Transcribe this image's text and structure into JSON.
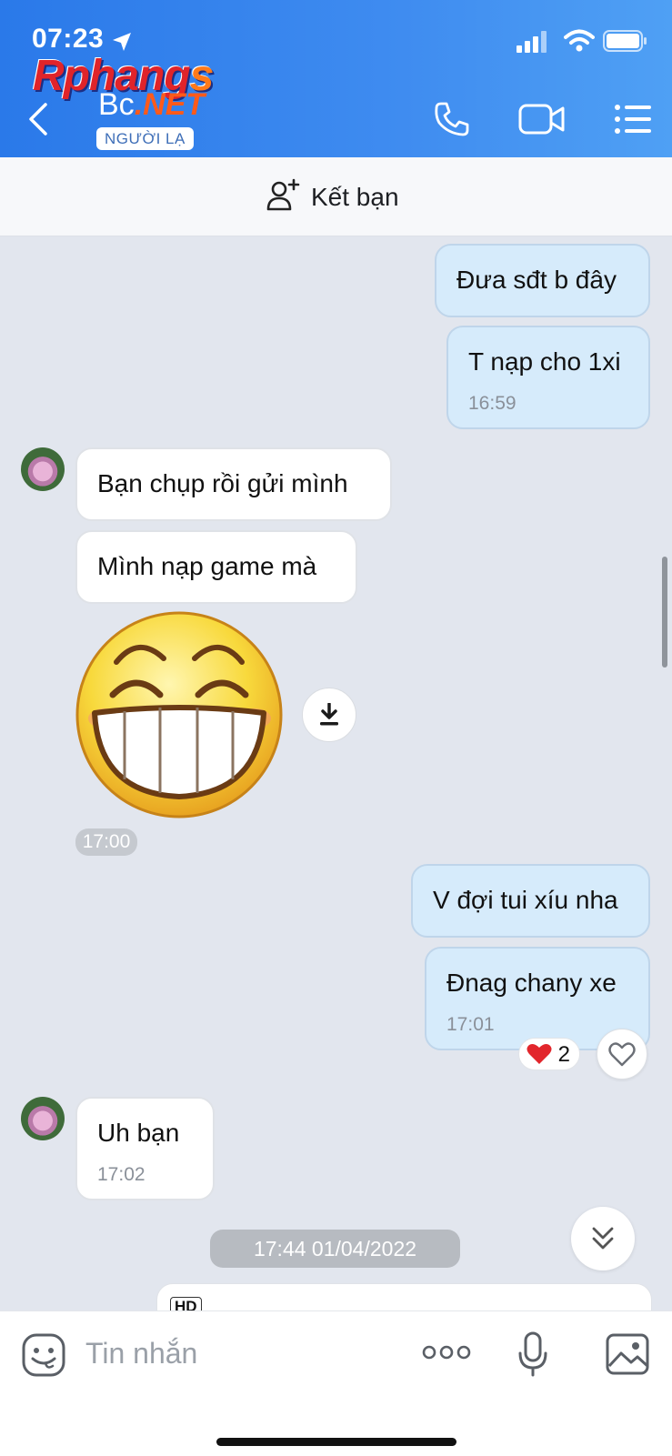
{
  "status_bar": {
    "time": "07:23"
  },
  "header": {
    "watermark": {
      "part1": "Rphang",
      "part2": "s"
    },
    "contact_name": {
      "part1": "Bc",
      "part2": ".NET"
    },
    "badge": "NGƯỜI LẠ"
  },
  "add_friend": {
    "label": "Kết bạn"
  },
  "messages": [
    {
      "side": "me",
      "text": "Đưa sđt b đây"
    },
    {
      "side": "me",
      "text": "T nạp cho 1xi",
      "time": "16:59"
    },
    {
      "side": "them",
      "text": "Bạn chụp rồi gửi mình"
    },
    {
      "side": "them",
      "text": "Mình nạp game mà"
    },
    {
      "side": "them",
      "sticker": "grinning-face-sticker",
      "time": "17:00"
    },
    {
      "side": "me",
      "text": "V đợi tui xíu nha"
    },
    {
      "side": "me",
      "text": "Đnag chany xe",
      "time": "17:01",
      "reaction": {
        "emoji": "❤️",
        "count": "2"
      }
    },
    {
      "side": "them",
      "text": "Uh bạn",
      "time": "17:02"
    }
  ],
  "date_separator": "17:44 01/04/2022",
  "partial_card_label": "HD",
  "composer": {
    "placeholder": "Tin nhắn"
  },
  "colors": {
    "header": "#2a79e9",
    "my_bubble": "#d6ebfb",
    "their_bubble": "#ffffff",
    "background": "#e2e6ee"
  }
}
